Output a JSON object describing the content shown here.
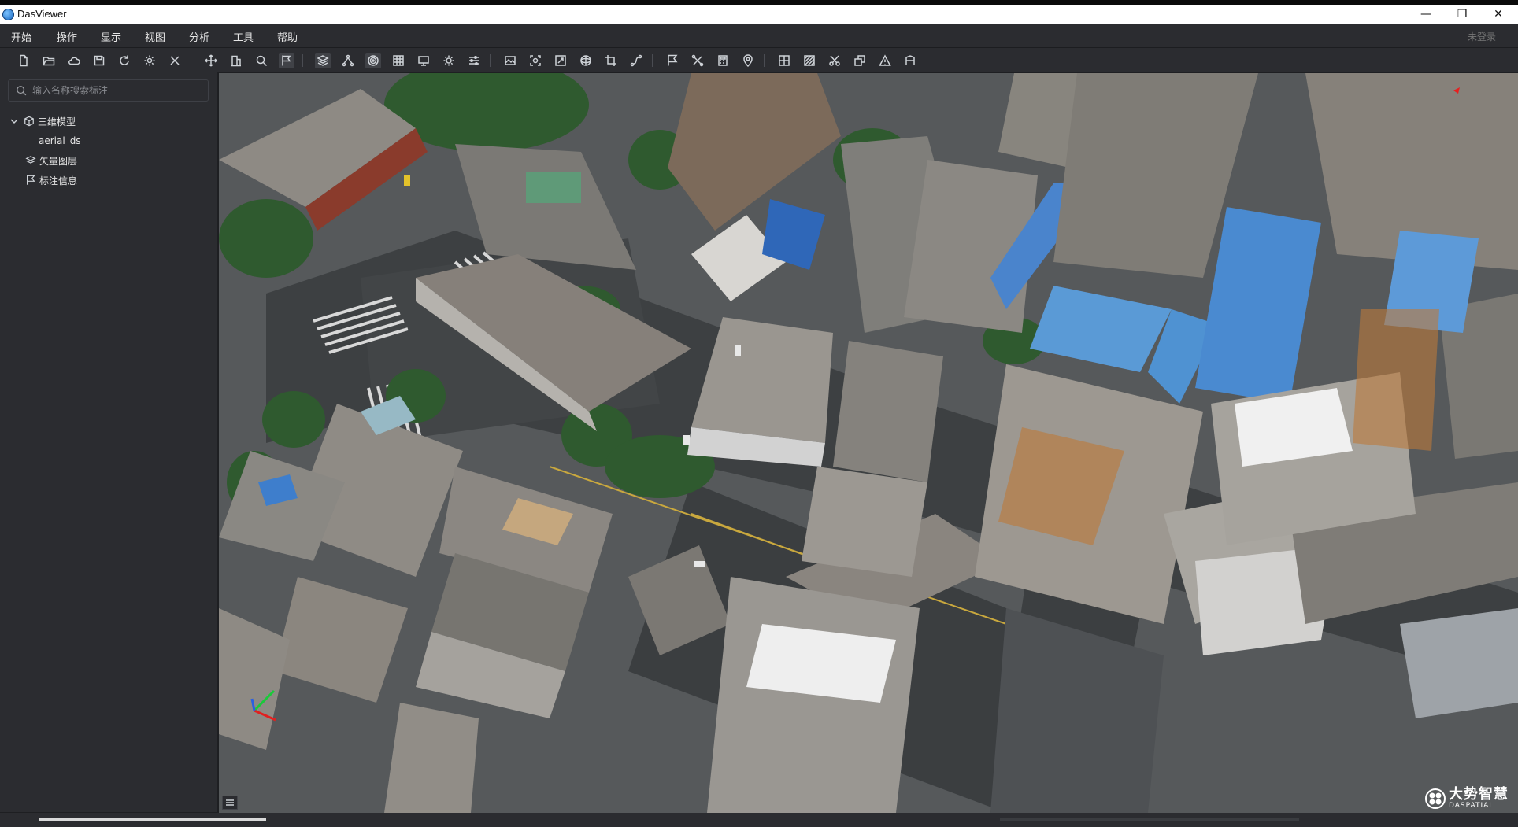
{
  "window": {
    "title": "DasViewer",
    "minimize": "—",
    "maximize": "❐",
    "close": "✕"
  },
  "menu": {
    "items": [
      "开始",
      "操作",
      "显示",
      "视图",
      "分析",
      "工具",
      "帮助"
    ],
    "login": "未登录"
  },
  "toolbar": {
    "icons": [
      "new-file-icon",
      "open-folder-icon",
      "cloud-icon",
      "save-icon",
      "refresh-icon",
      "settings-icon",
      "close-icon",
      "move-icon",
      "building-icon",
      "zoom-icon",
      "flag-icon",
      "layers-icon",
      "tree-icon",
      "target-icon",
      "grid-icon",
      "monitor-icon",
      "sun-icon",
      "sliders-icon",
      "image-icon",
      "capture-icon",
      "expand-icon",
      "sphere-icon",
      "crop-icon",
      "path-icon",
      "marker-flag-icon",
      "tools-icon",
      "calculator-icon",
      "pin-icon",
      "table-icon",
      "pattern-icon",
      "scissors-icon",
      "shapes-icon",
      "warning-icon",
      "measure-icon"
    ]
  },
  "sidebar": {
    "search_placeholder": "输入名称搜索标注",
    "tree": {
      "model_group": "三维模型",
      "model_item": "aerial_ds",
      "vector_layer": "矢量图层",
      "annotation": "标注信息"
    }
  },
  "viewport": {
    "brand_cn": "大势智慧",
    "brand_en": "DASPATIAL"
  }
}
